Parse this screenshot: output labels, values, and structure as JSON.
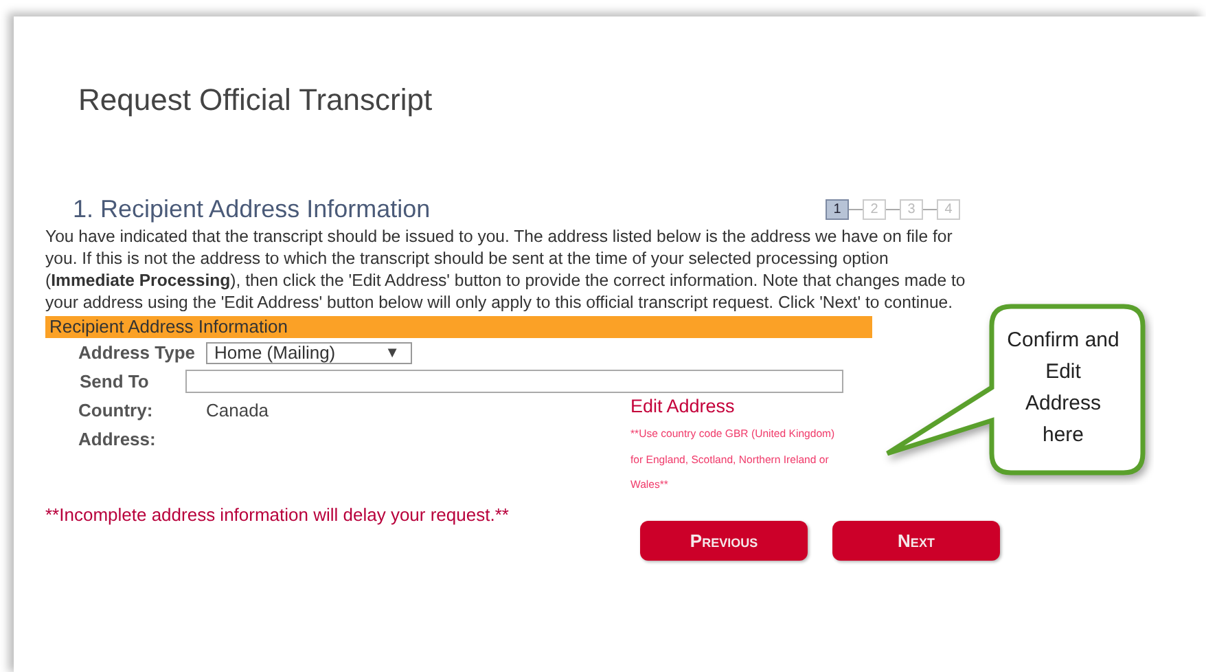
{
  "page": {
    "title": "Request Official Transcript"
  },
  "section": {
    "heading": "1. Recipient Address Information",
    "steps": [
      {
        "label": "1",
        "selected": true
      },
      {
        "label": "2",
        "selected": false
      },
      {
        "label": "3",
        "selected": false
      },
      {
        "label": "4",
        "selected": false
      }
    ],
    "intro": "You have indicated that the transcript should be issued to you. The address listed below is the address we have on file for you. If this is not the address to which the transcript should be sent at the time of your selected processing option (**Immediate Processing**), then click the 'Edit Address' button to provide the correct information. Note that changes made to your address using the 'Edit Address' button below will only apply to this official transcript request. Click 'Next' to continue."
  },
  "form": {
    "bar_title": "Recipient Address Information",
    "fields": [
      {
        "kind": "select",
        "label": "Address Type",
        "value": "Home (Mailing)",
        "caret": "▼"
      },
      {
        "kind": "input",
        "label": "Send To"
      },
      {
        "kind": "text",
        "label": "Country:",
        "value": "Canada"
      },
      {
        "kind": "text",
        "label": "Address:"
      }
    ],
    "edit_link": "Edit Address",
    "edit_note": "**Use country code GBR (United Kingdom) for England, Scotland, Northern Ireland or Wales**"
  },
  "warning": "**Incomplete address information will delay your request.**",
  "buttons": [
    {
      "label": "Previous"
    },
    {
      "label": "Next"
    }
  ],
  "callout": {
    "text": "Confirm and Edit Address here"
  }
}
